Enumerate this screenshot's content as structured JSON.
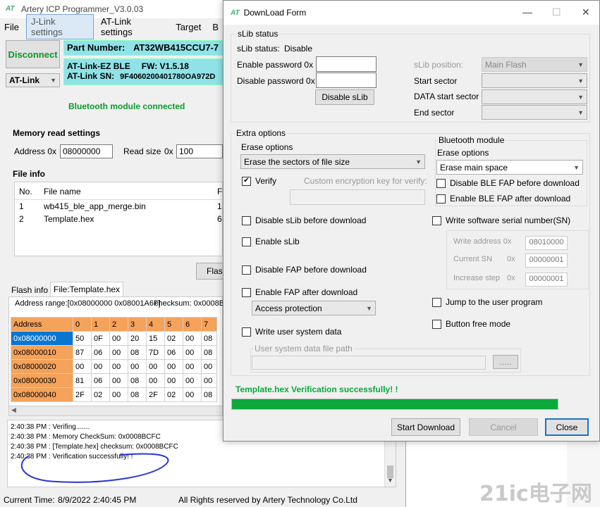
{
  "main_window": {
    "title": "Artery ICP Programmer_V3.0.03",
    "menu": [
      "File",
      "J-Link settings",
      "AT-Link settings",
      "Target",
      "B"
    ],
    "disconnect_label": "Disconnect",
    "device_select": "AT-Link",
    "part_number_label": "Part Number:",
    "part_number_value": "AT32WB415CCU7-7",
    "link_name": "AT-Link-EZ BLE",
    "fw_label": "FW: V1.5.18",
    "sn_label": "AT-Link SN:",
    "sn_value": "9F4060200401780OA972D",
    "bt_status": "Bluetooth module connected",
    "memory_read_settings": {
      "title": "Memory read settings",
      "address_label": "Address 0x",
      "address_value": "08000000",
      "read_size_label": "Read size",
      "read_size_prefix": "0x",
      "read_size_value": "100"
    },
    "file_info": {
      "title": "File info",
      "headers": [
        "No.",
        "File name",
        "Fi"
      ],
      "rows": [
        {
          "no": "1",
          "name": "wb415_ble_app_merge.bin",
          "extra": "1"
        },
        {
          "no": "2",
          "name": "Template.hex",
          "extra": "6"
        }
      ],
      "flash_button": "Flas"
    },
    "tabs": [
      "Flash info",
      "File:Template.hex"
    ],
    "address_range": "Address range:[0x08000000 0x08001A6F]",
    "checksum": "checksum: 0x0008BC",
    "hex_grid": {
      "headers": [
        "Address",
        "0",
        "1",
        "2",
        "3",
        "4",
        "5",
        "6",
        "7"
      ],
      "rows": [
        {
          "addr": "0x08000000",
          "bytes": [
            "50",
            "0F",
            "00",
            "20",
            "15",
            "02",
            "00",
            "08"
          ]
        },
        {
          "addr": "0x08000010",
          "bytes": [
            "87",
            "06",
            "00",
            "08",
            "7D",
            "06",
            "00",
            "08"
          ]
        },
        {
          "addr": "0x08000020",
          "bytes": [
            "00",
            "00",
            "00",
            "00",
            "00",
            "00",
            "00",
            "00"
          ]
        },
        {
          "addr": "0x08000030",
          "bytes": [
            "81",
            "06",
            "00",
            "08",
            "00",
            "00",
            "00",
            "00"
          ]
        },
        {
          "addr": "0x08000040",
          "bytes": [
            "2F",
            "02",
            "00",
            "08",
            "2F",
            "02",
            "00",
            "08"
          ]
        }
      ]
    },
    "log": [
      "2:40:38 PM : Verifing.......",
      "2:40:38 PM : Memory CheckSum: 0x0008BCFC",
      "2:40:38 PM :  [Template.hex] checksum: 0x0008BCFC",
      "2:40:38 PM : Verification successfully!  !"
    ],
    "current_time_label": "Current Time:",
    "current_time_value": "8/9/2022 2:40:45 PM",
    "copyright": "All Rights reserved by Artery Technology Co.Ltd"
  },
  "dialog": {
    "title": "DownLoad Form",
    "slib_status_group": "sLib status",
    "slib_status_label": "sLib status:",
    "slib_status_value": "Disable",
    "enable_password_label": "Enable password  0x",
    "disable_password_label": "Disable password 0x",
    "disable_slib_button": "Disable sLib",
    "slib_position_label": "sLib position:",
    "slib_position_value": "Main Flash",
    "start_sector_label": "Start sector",
    "data_start_sector_label": "DATA start sector",
    "end_sector_label": "End sector",
    "extra_options_group": "Extra options",
    "erase_options_label": "Erase options",
    "erase_options_value": "Erase the sectors of file size",
    "verify_label": "Verify",
    "custom_key_label": "Custom encryption key for verify:",
    "disable_slib_before_label": "Disable sLib before download",
    "enable_slib_label": "Enable sLib",
    "disable_fap_before_label": "Disable FAP before download",
    "enable_fap_after_label": "Enable FAP after download",
    "access_protection_value": "Access protection",
    "write_user_data_label": "Write user system data",
    "user_data_path_label": "User system data file path",
    "browse_button": ".....",
    "bt_module_group": "Bluetooth module",
    "bt_erase_options_label": "Erase options",
    "bt_erase_value": "Erase main space",
    "disable_ble_fap_label": "Disable BLE FAP before download",
    "enable_ble_fap_label": "Enable BLE FAP after download",
    "write_sn_label": "Write software serial number(SN)",
    "write_address_label": "Write address 0x",
    "write_address_value": "08010000",
    "current_sn_label": "Current SN",
    "current_sn_prefix": "0x",
    "current_sn_value": "00000001",
    "increase_step_label": "Increase step",
    "increase_step_prefix": "0x",
    "increase_step_value": "00000001",
    "jump_label": "Jump to the user program",
    "button_free_label": "Button free mode",
    "status_message": "Template.hex Verification successfully!  !",
    "progress_percent": 100,
    "start_download_button": "Start Download",
    "cancel_button": "Cancel",
    "close_button": "Close"
  },
  "watermark": "21ic电子网",
  "colors": {
    "accent_cyan": "#8fe3e8",
    "success_green": "#0aa93a",
    "hex_header_orange": "#f5a25a",
    "selected_blue": "#0a76d1",
    "annotation_blue": "#2a35d8"
  }
}
